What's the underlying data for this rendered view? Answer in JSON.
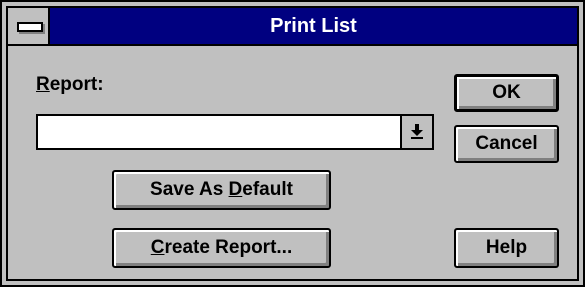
{
  "window": {
    "title": "Print List"
  },
  "report": {
    "label_mnemonic": "R",
    "label_rest": "eport:",
    "selected_value": ""
  },
  "buttons": {
    "ok": "OK",
    "cancel": "Cancel",
    "save_default_pre": "Save As ",
    "save_default_mnemonic": "D",
    "save_default_post": "efault",
    "create_report_mnemonic": "C",
    "create_report_rest": "reate Report...",
    "help": "Help"
  },
  "icons": {
    "system_menu": "system-menu-icon",
    "dropdown": "dropdown-arrow-icon"
  }
}
